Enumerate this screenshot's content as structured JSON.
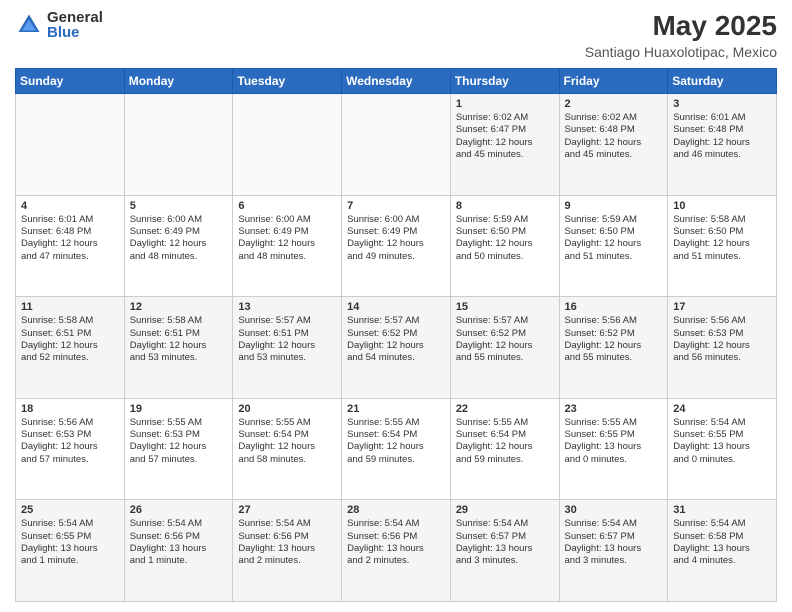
{
  "logo": {
    "general": "General",
    "blue": "Blue"
  },
  "header": {
    "title": "May 2025",
    "subtitle": "Santiago Huaxolotipac, Mexico"
  },
  "days_of_week": [
    "Sunday",
    "Monday",
    "Tuesday",
    "Wednesday",
    "Thursday",
    "Friday",
    "Saturday"
  ],
  "weeks": [
    [
      {
        "day": "",
        "content": ""
      },
      {
        "day": "",
        "content": ""
      },
      {
        "day": "",
        "content": ""
      },
      {
        "day": "",
        "content": ""
      },
      {
        "day": "1",
        "content": "Sunrise: 6:02 AM\nSunset: 6:47 PM\nDaylight: 12 hours\nand 45 minutes."
      },
      {
        "day": "2",
        "content": "Sunrise: 6:02 AM\nSunset: 6:48 PM\nDaylight: 12 hours\nand 45 minutes."
      },
      {
        "day": "3",
        "content": "Sunrise: 6:01 AM\nSunset: 6:48 PM\nDaylight: 12 hours\nand 46 minutes."
      }
    ],
    [
      {
        "day": "4",
        "content": "Sunrise: 6:01 AM\nSunset: 6:48 PM\nDaylight: 12 hours\nand 47 minutes."
      },
      {
        "day": "5",
        "content": "Sunrise: 6:00 AM\nSunset: 6:49 PM\nDaylight: 12 hours\nand 48 minutes."
      },
      {
        "day": "6",
        "content": "Sunrise: 6:00 AM\nSunset: 6:49 PM\nDaylight: 12 hours\nand 48 minutes."
      },
      {
        "day": "7",
        "content": "Sunrise: 6:00 AM\nSunset: 6:49 PM\nDaylight: 12 hours\nand 49 minutes."
      },
      {
        "day": "8",
        "content": "Sunrise: 5:59 AM\nSunset: 6:50 PM\nDaylight: 12 hours\nand 50 minutes."
      },
      {
        "day": "9",
        "content": "Sunrise: 5:59 AM\nSunset: 6:50 PM\nDaylight: 12 hours\nand 51 minutes."
      },
      {
        "day": "10",
        "content": "Sunrise: 5:58 AM\nSunset: 6:50 PM\nDaylight: 12 hours\nand 51 minutes."
      }
    ],
    [
      {
        "day": "11",
        "content": "Sunrise: 5:58 AM\nSunset: 6:51 PM\nDaylight: 12 hours\nand 52 minutes."
      },
      {
        "day": "12",
        "content": "Sunrise: 5:58 AM\nSunset: 6:51 PM\nDaylight: 12 hours\nand 53 minutes."
      },
      {
        "day": "13",
        "content": "Sunrise: 5:57 AM\nSunset: 6:51 PM\nDaylight: 12 hours\nand 53 minutes."
      },
      {
        "day": "14",
        "content": "Sunrise: 5:57 AM\nSunset: 6:52 PM\nDaylight: 12 hours\nand 54 minutes."
      },
      {
        "day": "15",
        "content": "Sunrise: 5:57 AM\nSunset: 6:52 PM\nDaylight: 12 hours\nand 55 minutes."
      },
      {
        "day": "16",
        "content": "Sunrise: 5:56 AM\nSunset: 6:52 PM\nDaylight: 12 hours\nand 55 minutes."
      },
      {
        "day": "17",
        "content": "Sunrise: 5:56 AM\nSunset: 6:53 PM\nDaylight: 12 hours\nand 56 minutes."
      }
    ],
    [
      {
        "day": "18",
        "content": "Sunrise: 5:56 AM\nSunset: 6:53 PM\nDaylight: 12 hours\nand 57 minutes."
      },
      {
        "day": "19",
        "content": "Sunrise: 5:55 AM\nSunset: 6:53 PM\nDaylight: 12 hours\nand 57 minutes."
      },
      {
        "day": "20",
        "content": "Sunrise: 5:55 AM\nSunset: 6:54 PM\nDaylight: 12 hours\nand 58 minutes."
      },
      {
        "day": "21",
        "content": "Sunrise: 5:55 AM\nSunset: 6:54 PM\nDaylight: 12 hours\nand 59 minutes."
      },
      {
        "day": "22",
        "content": "Sunrise: 5:55 AM\nSunset: 6:54 PM\nDaylight: 12 hours\nand 59 minutes."
      },
      {
        "day": "23",
        "content": "Sunrise: 5:55 AM\nSunset: 6:55 PM\nDaylight: 13 hours\nand 0 minutes."
      },
      {
        "day": "24",
        "content": "Sunrise: 5:54 AM\nSunset: 6:55 PM\nDaylight: 13 hours\nand 0 minutes."
      }
    ],
    [
      {
        "day": "25",
        "content": "Sunrise: 5:54 AM\nSunset: 6:55 PM\nDaylight: 13 hours\nand 1 minute."
      },
      {
        "day": "26",
        "content": "Sunrise: 5:54 AM\nSunset: 6:56 PM\nDaylight: 13 hours\nand 1 minute."
      },
      {
        "day": "27",
        "content": "Sunrise: 5:54 AM\nSunset: 6:56 PM\nDaylight: 13 hours\nand 2 minutes."
      },
      {
        "day": "28",
        "content": "Sunrise: 5:54 AM\nSunset: 6:56 PM\nDaylight: 13 hours\nand 2 minutes."
      },
      {
        "day": "29",
        "content": "Sunrise: 5:54 AM\nSunset: 6:57 PM\nDaylight: 13 hours\nand 3 minutes."
      },
      {
        "day": "30",
        "content": "Sunrise: 5:54 AM\nSunset: 6:57 PM\nDaylight: 13 hours\nand 3 minutes."
      },
      {
        "day": "31",
        "content": "Sunrise: 5:54 AM\nSunset: 6:58 PM\nDaylight: 13 hours\nand 4 minutes."
      }
    ]
  ]
}
